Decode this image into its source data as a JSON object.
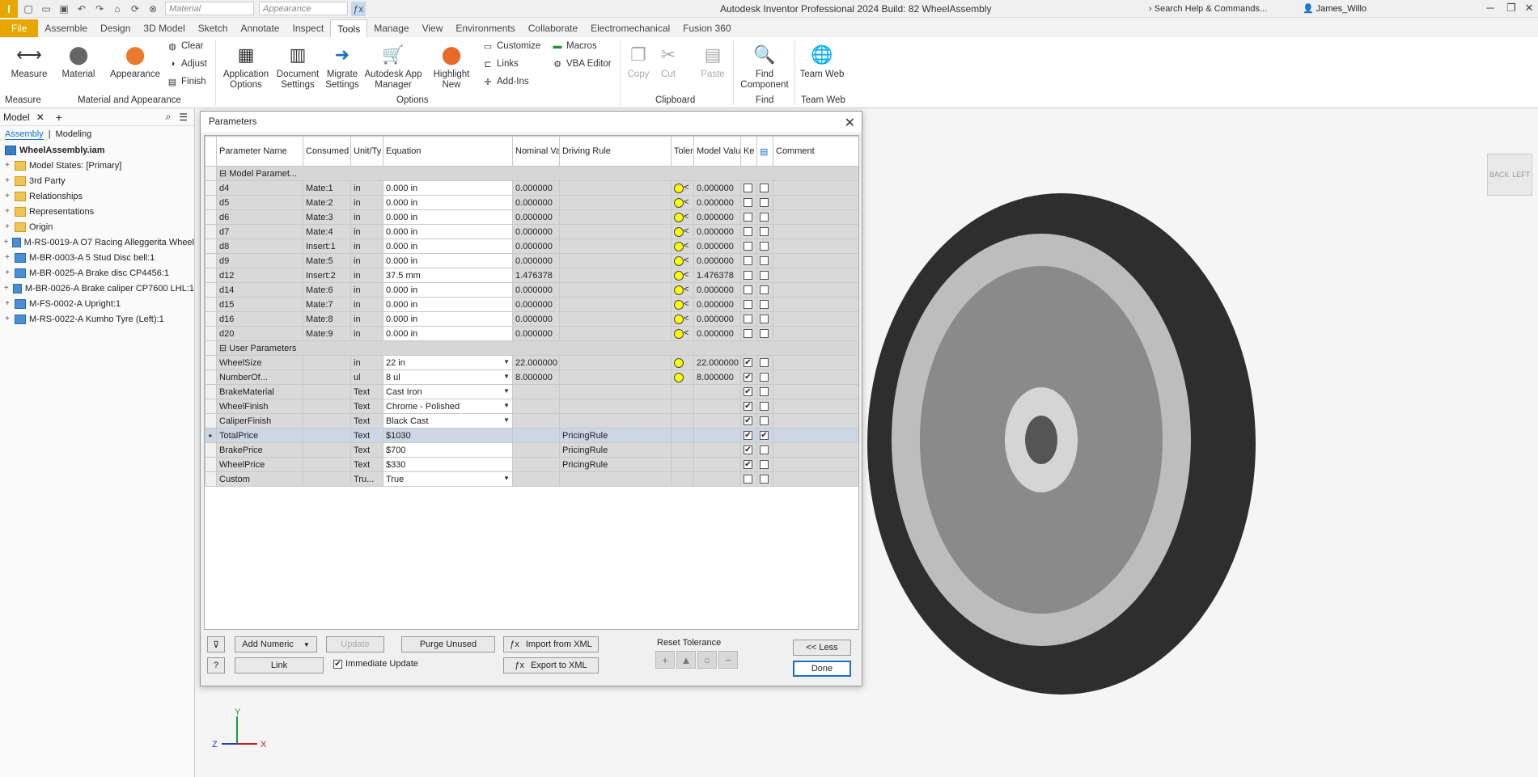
{
  "titlebar": {
    "app_title": "Autodesk Inventor Professional 2024 Build: 82   WheelAssembly",
    "material_combo": "Material",
    "appearance_combo": "Appearance",
    "search_placeholder": "Search Help & Commands...",
    "user": "James_Willo"
  },
  "tabs": [
    "File",
    "Assemble",
    "Design",
    "3D Model",
    "Sketch",
    "Annotate",
    "Inspect",
    "Tools",
    "Manage",
    "View",
    "Environments",
    "Collaborate",
    "Electromechanical",
    "Fusion 360"
  ],
  "ribbon": {
    "measure": "Measure",
    "material": "Material",
    "appearance": "Appearance",
    "clear": "Clear",
    "adjust": "Adjust",
    "finish": "Finish",
    "app_options": "Application Options",
    "doc_settings": "Document Settings",
    "migrate": "Migrate Settings",
    "app_manager": "Autodesk App Manager",
    "highlight": "Highlight New",
    "customize": "Customize",
    "links": "Links",
    "addins": "Add-Ins",
    "macros": "Macros",
    "vba": "VBA Editor",
    "copy": "Copy",
    "cut": "Cut",
    "paste": "Paste",
    "find_component": "Find Component",
    "team_web": "Team Web",
    "panel_measure": "Measure",
    "panel_material": "Material and Appearance",
    "panel_options": "Options",
    "panel_clipboard": "Clipboard",
    "panel_find": "Find",
    "panel_teamweb": "Team Web"
  },
  "browser": {
    "title": "Model",
    "tab_assembly": "Assembly",
    "tab_modeling": "Modeling",
    "root": "WheelAssembly.iam",
    "items": [
      "Model States: [Primary]",
      "3rd Party",
      "Relationships",
      "Representations",
      "Origin",
      "M-RS-0019-A O7 Racing Alleggerita Wheel",
      "M-BR-0003-A 5 Stud Disc bell:1",
      "M-BR-0025-A Brake disc CP4456:1",
      "M-BR-0026-A Brake caliper CP7600 LHL:1",
      "M-FS-0002-A Upright:1",
      "M-RS-0022-A Kumho Tyre (Left):1"
    ]
  },
  "viewcube": {
    "back": "BACK",
    "left": "LEFT"
  },
  "dialog": {
    "title": "Parameters",
    "headers": [
      "Parameter Name",
      "Consumed",
      "Unit/Ty",
      "Equation",
      "Nominal Va",
      "Driving Rule",
      "Toler",
      "Model Valu",
      "Ke",
      "",
      "Comment"
    ],
    "group_model": "Model Paramet...",
    "group_user": "User Parameters",
    "model_rows": [
      {
        "name": "d4",
        "consumed": "Mate:1",
        "unit": "in",
        "eq": "0.000 in",
        "nom": "0.000000",
        "model": "0.000000"
      },
      {
        "name": "d5",
        "consumed": "Mate:2",
        "unit": "in",
        "eq": "0.000 in",
        "nom": "0.000000",
        "model": "0.000000"
      },
      {
        "name": "d6",
        "consumed": "Mate:3",
        "unit": "in",
        "eq": "0.000 in",
        "nom": "0.000000",
        "model": "0.000000"
      },
      {
        "name": "d7",
        "consumed": "Mate:4",
        "unit": "in",
        "eq": "0.000 in",
        "nom": "0.000000",
        "model": "0.000000"
      },
      {
        "name": "d8",
        "consumed": "Insert:1",
        "unit": "in",
        "eq": "0.000 in",
        "nom": "0.000000",
        "model": "0.000000"
      },
      {
        "name": "d9",
        "consumed": "Mate:5",
        "unit": "in",
        "eq": "0.000 in",
        "nom": "0.000000",
        "model": "0.000000"
      },
      {
        "name": "d12",
        "consumed": "Insert:2",
        "unit": "in",
        "eq": "37.5 mm",
        "nom": "1.476378",
        "model": "1.476378"
      },
      {
        "name": "d14",
        "consumed": "Mate:6",
        "unit": "in",
        "eq": "0.000 in",
        "nom": "0.000000",
        "model": "0.000000"
      },
      {
        "name": "d15",
        "consumed": "Mate:7",
        "unit": "in",
        "eq": "0.000 in",
        "nom": "0.000000",
        "model": "0.000000"
      },
      {
        "name": "d16",
        "consumed": "Mate:8",
        "unit": "in",
        "eq": "0.000 in",
        "nom": "0.000000",
        "model": "0.000000"
      },
      {
        "name": "d20",
        "consumed": "Mate:9",
        "unit": "in",
        "eq": "0.000 in",
        "nom": "0.000000",
        "model": "0.000000"
      }
    ],
    "user_rows": [
      {
        "name": "WheelSize",
        "unit": "in",
        "eq": "22 in",
        "nom": "22.000000",
        "rule": "",
        "model": "22.000000",
        "tol": true,
        "dd": true,
        "key": true,
        "exp": false
      },
      {
        "name": "NumberOf...",
        "unit": "ul",
        "eq": "8 ul",
        "nom": "8.000000",
        "rule": "",
        "model": "8.000000",
        "tol": true,
        "dd": true,
        "key": true,
        "exp": false
      },
      {
        "name": "BrakeMaterial",
        "unit": "Text",
        "eq": "Cast Iron",
        "nom": "",
        "rule": "",
        "model": "",
        "tol": false,
        "dd": true,
        "key": true,
        "exp": false
      },
      {
        "name": "WheelFinish",
        "unit": "Text",
        "eq": "Chrome - Polished",
        "nom": "",
        "rule": "",
        "model": "",
        "tol": false,
        "dd": true,
        "key": true,
        "exp": false
      },
      {
        "name": "CaliperFinish",
        "unit": "Text",
        "eq": "Black Cast",
        "nom": "",
        "rule": "",
        "model": "",
        "tol": false,
        "dd": true,
        "key": true,
        "exp": false
      },
      {
        "name": "TotalPrice",
        "unit": "Text",
        "eq": "$1030",
        "nom": "",
        "rule": "PricingRule",
        "model": "",
        "tol": false,
        "dd": false,
        "key": true,
        "exp": true
      },
      {
        "name": "BrakePrice",
        "unit": "Text",
        "eq": "$700",
        "nom": "",
        "rule": "PricingRule",
        "model": "",
        "tol": false,
        "dd": false,
        "key": true,
        "exp": false
      },
      {
        "name": "WheelPrice",
        "unit": "Text",
        "eq": "$330",
        "nom": "",
        "rule": "PricingRule",
        "model": "",
        "tol": false,
        "dd": false,
        "key": true,
        "exp": false
      },
      {
        "name": "Custom",
        "unit": "Tru...",
        "eq": "True",
        "nom": "",
        "rule": "",
        "model": "",
        "tol": false,
        "dd": true,
        "key": false,
        "exp": false
      }
    ],
    "add_numeric": "Add Numeric",
    "update": "Update",
    "purge": "Purge Unused",
    "import_xml": "Import from XML",
    "export_xml": "Export to XML",
    "link": "Link",
    "immediate_update": "Immediate Update",
    "reset_tolerance": "Reset Tolerance",
    "less": "<< Less",
    "done": "Done"
  },
  "triad": {
    "x": "X",
    "y": "Y",
    "z": "Z"
  }
}
